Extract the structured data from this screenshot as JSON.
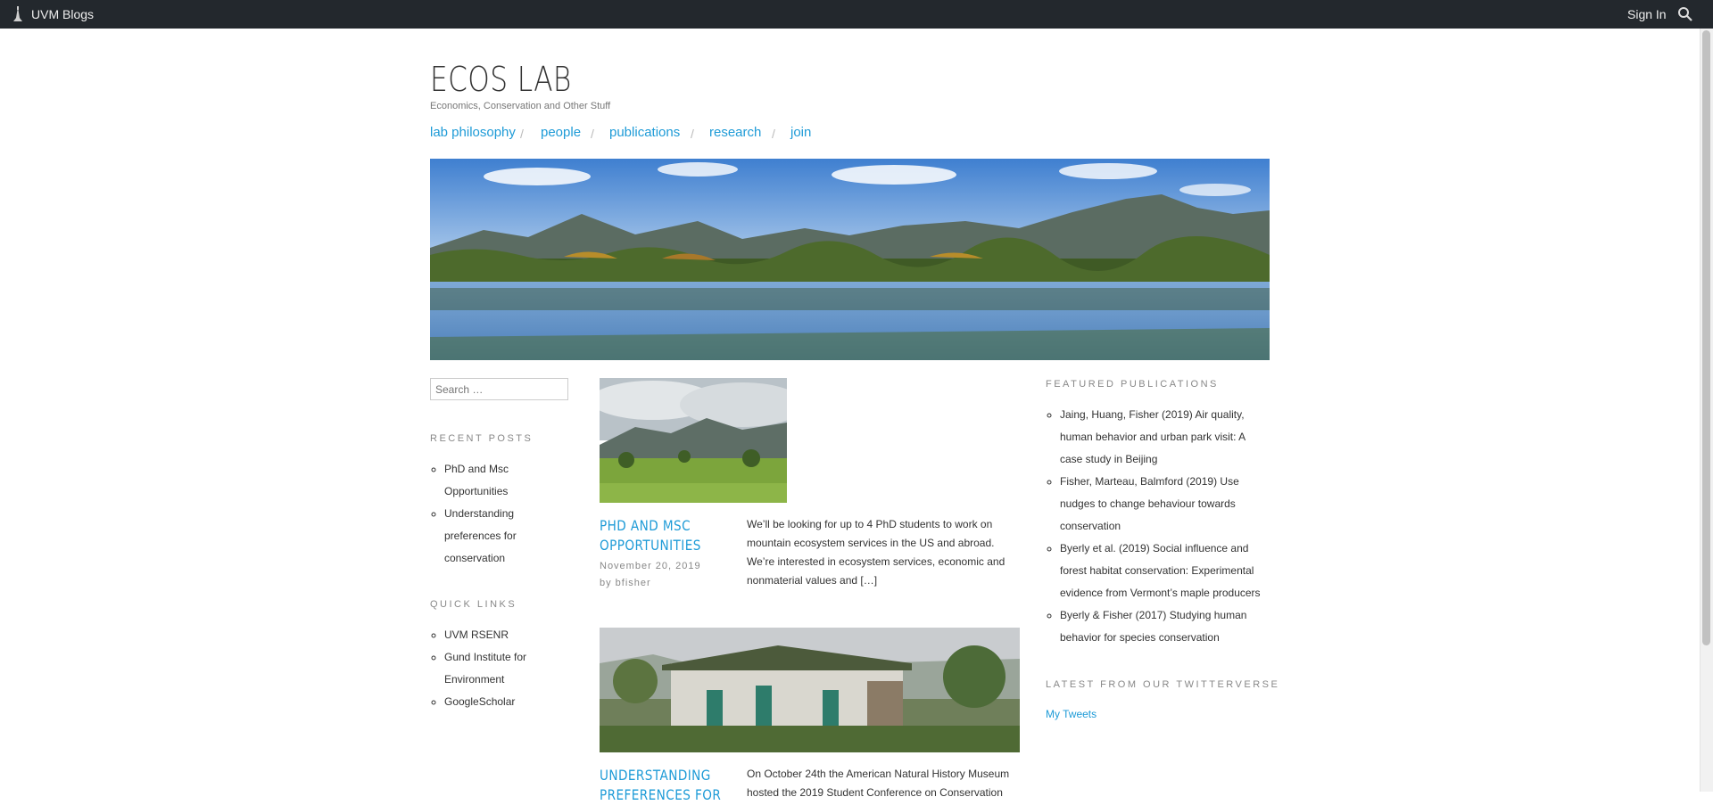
{
  "adminbar": {
    "site_label": "UVM Blogs",
    "sign_in_label": "Sign In",
    "bg_color": "#23282d"
  },
  "header": {
    "title": "ECOS LAB",
    "tagline": "Economics, Conservation and Other Stuff"
  },
  "nav": {
    "items": [
      {
        "label": "lab philosophy"
      },
      {
        "label": "people"
      },
      {
        "label": "publications"
      },
      {
        "label": "research"
      },
      {
        "label": "join"
      }
    ],
    "separator": "/",
    "link_color": "#1e9bd7"
  },
  "sidebar_left": {
    "search_placeholder": "Search …",
    "recent_posts_title": "RECENT POSTS",
    "recent_posts": [
      {
        "line1": "PhD and Msc",
        "line2": "Opportunities"
      },
      {
        "line1": "Understanding",
        "line2": "preferences for",
        "line3": "conservation"
      }
    ],
    "quick_links_title": "QUICK LINKS",
    "quick_links": [
      {
        "line1": "UVM RSENR"
      },
      {
        "line1": "Gund Institute for",
        "line2": "Environment"
      },
      {
        "line1": "GoogleScholar"
      }
    ]
  },
  "posts": [
    {
      "title_line1": "PHD AND MSC",
      "title_line2": "OPPORTUNITIES",
      "date": "November 20, 2019",
      "author": "by bfisher",
      "excerpt_lines": [
        "We’ll be looking for up to 4 PhD students to work on",
        "mountain ecosystem services in the US and abroad.",
        "We’re interested in ecosystem services, economic and",
        "nonmaterial values and […]"
      ]
    },
    {
      "title_line1": "UNDERSTANDING",
      "title_line2": "PREFERENCES FOR",
      "excerpt_lines": [
        "On October 24th the American Natural History Museum",
        "hosted the 2019 Student Conference on Conservation"
      ]
    }
  ],
  "sidebar_right": {
    "featured_title": "FEATURED PUBLICATIONS",
    "featured": [
      {
        "lines": [
          "Jaing, Huang, Fisher (2019) Air quality,",
          "human behavior and urban park visit: A",
          "case study in Beijing"
        ]
      },
      {
        "lines": [
          "Fisher, Marteau, Balmford (2019) Use",
          "nudges to change behaviour towards",
          "conservation"
        ]
      },
      {
        "lines": [
          "Byerly et al. (2019) Social influence and",
          "forest habitat conservation: Experimental",
          "evidence from Vermont’s maple producers"
        ]
      },
      {
        "lines": [
          "Byerly & Fisher (2017) Studying human",
          "behavior for species conservation"
        ]
      }
    ],
    "twitter_title": "LATEST FROM OUR TWITTERVERSE",
    "tweets_link": "My Tweets"
  }
}
